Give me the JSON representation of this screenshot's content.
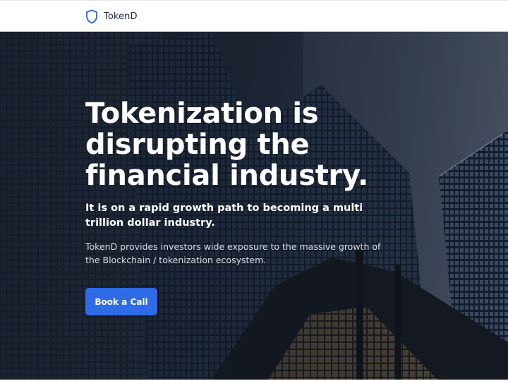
{
  "nav": {
    "brand_name": "TokenD",
    "brand_icon": "shield-icon",
    "accent_color": "#2563eb"
  },
  "hero": {
    "headline": "Tokenization is\ndisrupting the\nfinancial industry.",
    "subheadline": "It is on a rapid growth path to becoming a multi trillion dollar industry.",
    "description": "TokenD provides investors wide exposure to the massive growth of the Blockchain / tokenization ecosystem.",
    "cta_label": "Book a Call",
    "cta_color": "#2f6be6",
    "background_image": "dark skyscraper facades viewed from below"
  }
}
